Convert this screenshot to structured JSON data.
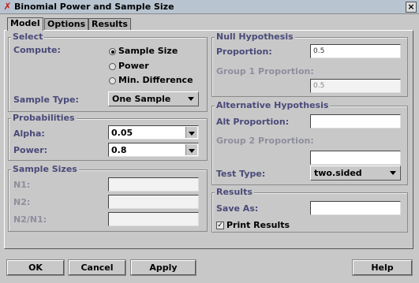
{
  "window": {
    "title": "Binomial Power and Sample Size",
    "close_symbol": "×",
    "app_icon": "x-logo-icon"
  },
  "tabs": [
    {
      "label": "Model",
      "active": true
    },
    {
      "label": "Options",
      "active": false
    },
    {
      "label": "Results",
      "active": false
    }
  ],
  "select": {
    "legend": "Select",
    "compute_label": "Compute:",
    "options": [
      {
        "label": "Sample Size",
        "checked": true
      },
      {
        "label": "Power",
        "checked": false
      },
      {
        "label": "Min. Difference",
        "checked": false
      }
    ],
    "sample_type_label": "Sample Type:",
    "sample_type_value": "One Sample"
  },
  "probabilities": {
    "legend": "Probabilities",
    "alpha_label": "Alpha:",
    "alpha_value": "0.05",
    "power_label": "Power:",
    "power_value": "0.8"
  },
  "sample_sizes": {
    "legend": "Sample Sizes",
    "n1_label": "N1:",
    "n2_label": "N2:",
    "n2n1_label": "N2/N1:"
  },
  "null_hypothesis": {
    "legend": "Null Hypothesis",
    "proportion_label": "Proportion:",
    "proportion_value": "0.5",
    "group1_label": "Group 1 Proportion:",
    "group1_value": "0.5"
  },
  "alternative_hypothesis": {
    "legend": "Alternative Hypothesis",
    "alt_proportion_label": "Alt Proportion:",
    "group2_label": "Group 2 Proportion:",
    "test_type_label": "Test Type:",
    "test_type_value": "two.sided"
  },
  "results": {
    "legend": "Results",
    "save_as_label": "Save As:",
    "print_results_label": "Print Results",
    "print_results_checked": true
  },
  "buttons": {
    "ok": "OK",
    "cancel": "Cancel",
    "apply": "Apply",
    "help": "Help"
  },
  "colors": {
    "accent_label": "#4a4a7a",
    "background": "#c8c8c8",
    "titlebar": "#b8c4d0"
  }
}
